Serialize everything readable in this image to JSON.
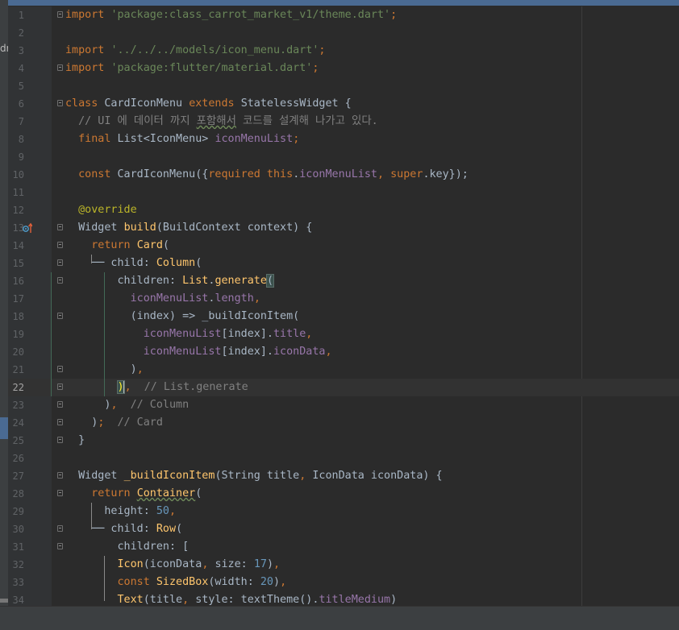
{
  "editor": {
    "current_line": 22,
    "lines": [
      {
        "n": "1",
        "fold": true,
        "segs": [
          [
            "kw",
            "import "
          ],
          [
            "str",
            "'package:class_carrot_market_v1/theme.dart'"
          ],
          [
            "kw",
            ";"
          ]
        ]
      },
      {
        "n": "2",
        "segs": []
      },
      {
        "n": "3",
        "segs": [
          [
            "kw",
            "import "
          ],
          [
            "str",
            "'../../../models/icon_menu.dart'"
          ],
          [
            "kw",
            ";"
          ]
        ]
      },
      {
        "n": "4",
        "fold": true,
        "segs": [
          [
            "kw",
            "import "
          ],
          [
            "str",
            "'package:flutter/material.dart'"
          ],
          [
            "kw",
            ";"
          ]
        ]
      },
      {
        "n": "5",
        "segs": []
      },
      {
        "n": "6",
        "fold": true,
        "segs": [
          [
            "kw",
            "class "
          ],
          [
            "",
            "CardIconMenu "
          ],
          [
            "kw",
            "extends "
          ],
          [
            "",
            "StatelessWidget {"
          ]
        ]
      },
      {
        "n": "7",
        "segs": [
          [
            "cmt",
            "  // UI 에 데이터 까지 "
          ],
          [
            "cmt wav",
            "포함해서"
          ],
          [
            "cmt",
            " 코드를 설계해 나가고 있다."
          ]
        ]
      },
      {
        "n": "8",
        "segs": [
          [
            "kw",
            "  final "
          ],
          [
            "",
            "List<IconMenu> "
          ],
          [
            "fld",
            "iconMenuList"
          ],
          [
            "kw",
            ";"
          ]
        ]
      },
      {
        "n": "9",
        "segs": []
      },
      {
        "n": "10",
        "segs": [
          [
            "kw",
            "  const "
          ],
          [
            "",
            "CardIconMenu({"
          ],
          [
            "kw",
            "required this"
          ],
          [
            "",
            "."
          ],
          [
            "fld",
            "iconMenuList"
          ],
          [
            "kw",
            ", super"
          ],
          [
            "",
            ".key});"
          ]
        ]
      },
      {
        "n": "11",
        "segs": []
      },
      {
        "n": "12",
        "segs": [
          [
            "ann",
            "  @override"
          ]
        ]
      },
      {
        "n": "13",
        "fold": true,
        "segs": [
          [
            "",
            "  Widget "
          ],
          [
            "fn",
            "build"
          ],
          [
            "",
            "(BuildContext context) {"
          ]
        ]
      },
      {
        "n": "14",
        "fold": true,
        "segs": [
          [
            "kw",
            "    return "
          ],
          [
            "fn",
            "Card"
          ],
          [
            "",
            "("
          ]
        ]
      },
      {
        "n": "15",
        "fold": true,
        "segs": [
          [
            "",
            "    ── child: "
          ],
          [
            "fn",
            "Column"
          ],
          [
            "",
            "("
          ]
        ]
      },
      {
        "n": "16",
        "fold": true,
        "segs": [
          [
            "",
            "        children: "
          ],
          [
            "fn",
            "List"
          ],
          [
            "",
            "."
          ],
          [
            "fn",
            "generate"
          ],
          [
            "br",
            "("
          ]
        ]
      },
      {
        "n": "17",
        "segs": [
          [
            "fld",
            "          iconMenuList"
          ],
          [
            "",
            "."
          ],
          [
            "fld",
            "length"
          ],
          [
            "kw",
            ","
          ]
        ]
      },
      {
        "n": "18",
        "fold": true,
        "segs": [
          [
            "",
            "          (index) => _buildIconItem("
          ]
        ]
      },
      {
        "n": "19",
        "segs": [
          [
            "fld",
            "            iconMenuList"
          ],
          [
            "",
            "[index]."
          ],
          [
            "fld",
            "title"
          ],
          [
            "kw",
            ","
          ]
        ]
      },
      {
        "n": "20",
        "segs": [
          [
            "fld",
            "            iconMenuList"
          ],
          [
            "",
            "[index]."
          ],
          [
            "fld",
            "iconData"
          ],
          [
            "kw",
            ","
          ]
        ]
      },
      {
        "n": "21",
        "fold": true,
        "segs": [
          [
            "",
            "          )"
          ],
          [
            "kw",
            ","
          ]
        ]
      },
      {
        "n": "22",
        "fold": true,
        "segs": [
          [
            "",
            "        "
          ],
          [
            "caret",
            ")"
          ],
          [
            "kw",
            ","
          ],
          [
            "cmt",
            "  // List.generate"
          ]
        ]
      },
      {
        "n": "23",
        "fold": true,
        "segs": [
          [
            "",
            "      )"
          ],
          [
            "kw",
            ","
          ],
          [
            "cmt",
            "  // Column"
          ]
        ]
      },
      {
        "n": "24",
        "fold": true,
        "segs": [
          [
            "",
            "    )"
          ],
          [
            "kw",
            ";"
          ],
          [
            "cmt",
            "  // Card"
          ]
        ]
      },
      {
        "n": "25",
        "fold": true,
        "segs": [
          [
            "",
            "  }"
          ]
        ]
      },
      {
        "n": "26",
        "segs": []
      },
      {
        "n": "27",
        "fold": true,
        "segs": [
          [
            "",
            "  Widget "
          ],
          [
            "fn",
            "_buildIconItem"
          ],
          [
            "",
            "(String title"
          ],
          [
            "kw",
            ", "
          ],
          [
            "",
            "IconData iconData) {"
          ]
        ]
      },
      {
        "n": "28",
        "fold": true,
        "segs": [
          [
            "kw",
            "    return "
          ],
          [
            "fn wav",
            "Container"
          ],
          [
            "",
            "("
          ]
        ]
      },
      {
        "n": "29",
        "segs": [
          [
            "",
            "      height: "
          ],
          [
            "num",
            "50"
          ],
          [
            "kw",
            ","
          ]
        ]
      },
      {
        "n": "30",
        "fold": true,
        "segs": [
          [
            "",
            "    ── child: "
          ],
          [
            "fn",
            "Row"
          ],
          [
            "",
            "("
          ]
        ]
      },
      {
        "n": "31",
        "fold": true,
        "segs": [
          [
            "",
            "        children: ["
          ]
        ]
      },
      {
        "n": "32",
        "segs": [
          [
            "",
            "        "
          ],
          [
            "fn",
            "Icon"
          ],
          [
            "",
            "(iconData"
          ],
          [
            "kw",
            ", "
          ],
          [
            "",
            "size: "
          ],
          [
            "num",
            "17"
          ],
          [
            "",
            ")"
          ],
          [
            "kw",
            ","
          ]
        ]
      },
      {
        "n": "33",
        "segs": [
          [
            "kw",
            "        const "
          ],
          [
            "fn",
            "SizedBox"
          ],
          [
            "",
            "(width: "
          ],
          [
            "num",
            "20"
          ],
          [
            "",
            ")"
          ],
          [
            "kw",
            ","
          ]
        ]
      },
      {
        "n": "34",
        "segs": [
          [
            "",
            "        "
          ],
          [
            "fn",
            "Text"
          ],
          [
            "",
            "(title"
          ],
          [
            "kw",
            ", "
          ],
          [
            "",
            "style: textTheme()."
          ],
          [
            "fld",
            "titleMedium"
          ],
          [
            "",
            ")"
          ]
        ]
      }
    ]
  },
  "left_panel_fragment": "dr"
}
